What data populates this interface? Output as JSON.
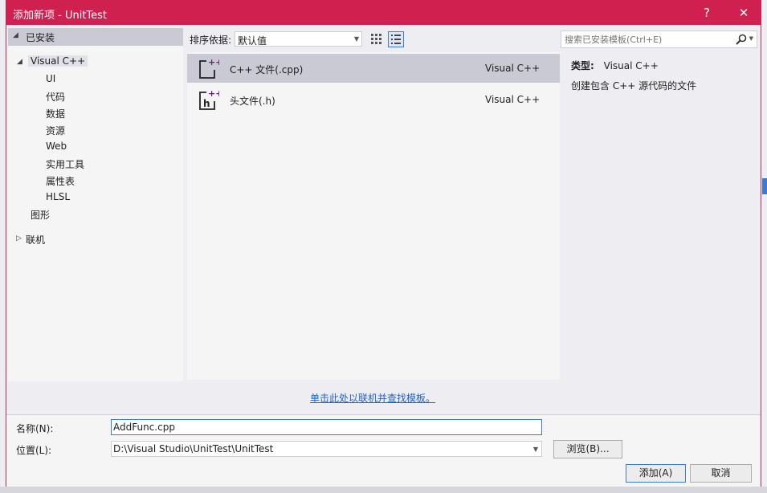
{
  "dialog": {
    "title": "添加新项 - UnitTest",
    "help_label": "?",
    "close_label": "✕"
  },
  "tree": {
    "root_label": "已安装",
    "visual_cpp": "Visual C++",
    "children": [
      "UI",
      "代码",
      "数据",
      "资源",
      "Web",
      "实用工具",
      "属性表",
      "HLSL"
    ],
    "graphics": "图形",
    "online": "联机"
  },
  "toolbar": {
    "sort_label": "排序依据:",
    "sort_value": "默认值"
  },
  "search": {
    "placeholder": "搜索已安装模板(Ctrl+E)"
  },
  "templates": [
    {
      "name": "C++ 文件(.cpp)",
      "language": "Visual C++",
      "icon": "cpp-file-icon"
    },
    {
      "name": "头文件(.h)",
      "language": "Visual C++",
      "icon": "header-file-icon"
    }
  ],
  "details": {
    "type_label": "类型:",
    "type_value": "Visual C++",
    "description": "创建包含 C++ 源代码的文件"
  },
  "online_link": "单击此处以联机并查找模板。",
  "form": {
    "name_label": "名称(N):",
    "name_value": "AddFunc.cpp",
    "location_label": "位置(L):",
    "location_value": "D:\\Visual Studio\\UnitTest\\UnitTest",
    "browse_label": "浏览(B)...",
    "add_label": "添加(A)",
    "cancel_label": "取消"
  },
  "colors": {
    "accent": "#d0204f",
    "link": "#1e61c8",
    "selection": "#cacad4",
    "focus": "#3b7bd8"
  }
}
